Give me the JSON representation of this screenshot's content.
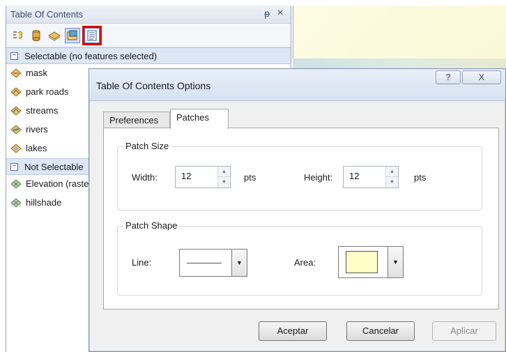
{
  "toc": {
    "title": "Table Of Contents",
    "pin_glyph": "ᵽ",
    "close_glyph": "×",
    "toolbar": [
      {
        "name": "list-by-drawing-order-icon"
      },
      {
        "name": "list-by-source-icon"
      },
      {
        "name": "list-by-visibility-icon"
      },
      {
        "name": "list-by-selection-icon"
      },
      {
        "name": "options-icon"
      }
    ],
    "groups": [
      {
        "label": "Selectable (no features selected)",
        "toggle": "−",
        "layers": [
          "mask",
          "park roads",
          "streams",
          "rivers",
          "lakes"
        ]
      },
      {
        "label": "Not Selectable",
        "toggle": "−",
        "layers": [
          "Elevation (raster)",
          "hillshade"
        ]
      }
    ]
  },
  "dialog": {
    "title": "Table Of Contents Options",
    "help_glyph": "?",
    "close_glyph": "X",
    "tabs": [
      "Preferences",
      "Patches"
    ],
    "active_tab": "Patches",
    "patch_size": {
      "legend": "Patch Size",
      "width_label": "Width:",
      "width_value": "12",
      "width_unit": "pts",
      "height_label": "Height:",
      "height_value": "12",
      "height_unit": "pts"
    },
    "patch_shape": {
      "legend": "Patch Shape",
      "line_label": "Line:",
      "area_label": "Area:",
      "area_fill_color": "#fffdc8"
    },
    "buttons": {
      "ok": "Aceptar",
      "cancel": "Cancelar",
      "apply": "Aplicar"
    }
  }
}
